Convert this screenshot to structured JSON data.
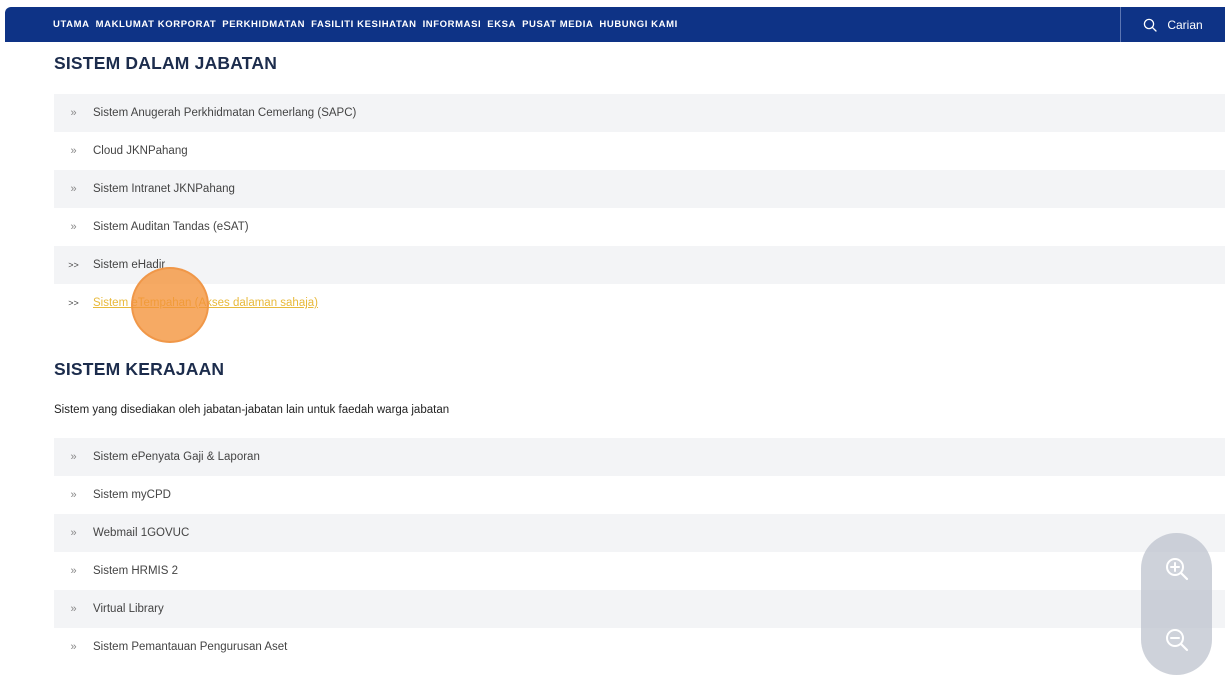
{
  "nav": {
    "items": [
      "UTAMA",
      "MAKLUMAT KORPORAT",
      "PERKHIDMATAN",
      "FASILITI KESIHATAN",
      "INFORMASI",
      "EKSA",
      "PUSAT MEDIA",
      "HUBUNGI KAMI"
    ],
    "search_label": "Carian"
  },
  "section1": {
    "title": "SISTEM DALAM JABATAN",
    "items": [
      {
        "chev": "»",
        "label": "Sistem Anugerah Perkhidmatan Cemerlang (SAPC)"
      },
      {
        "chev": "»",
        "label": "Cloud JKNPahang"
      },
      {
        "chev": "»",
        "label": "Sistem Intranet JKNPahang"
      },
      {
        "chev": "»",
        "label": "Sistem Auditan Tandas (eSAT)"
      },
      {
        "chev": ">>",
        "label": "Sistem eHadir"
      },
      {
        "chev": ">>",
        "label": "Sistem eTempahan (Akses dalaman sahaja)"
      }
    ]
  },
  "section2": {
    "title": "SISTEM KERAJAAN",
    "description": "Sistem yang disediakan oleh jabatan-jabatan lain untuk faedah warga jabatan",
    "items": [
      {
        "chev": "»",
        "label": "Sistem ePenyata Gaji & Laporan"
      },
      {
        "chev": "»",
        "label": "Sistem myCPD"
      },
      {
        "chev": "»",
        "label": "Webmail 1GOVUC"
      },
      {
        "chev": "»",
        "label": "Sistem HRMIS 2"
      },
      {
        "chev": "»",
        "label": "Virtual Library"
      },
      {
        "chev": "»",
        "label": "Sistem Pemantauan Pengurusan Aset"
      }
    ]
  },
  "colors": {
    "nav_bg": "#0e3386",
    "heading": "#1c2c4c",
    "link_highlight": "#e8b93a",
    "row_alt": "#f3f4f6",
    "click_indicator": "#f49238"
  },
  "icons": {
    "search": "search-icon",
    "zoom_in": "zoom-in-icon",
    "zoom_out": "zoom-out-icon"
  }
}
